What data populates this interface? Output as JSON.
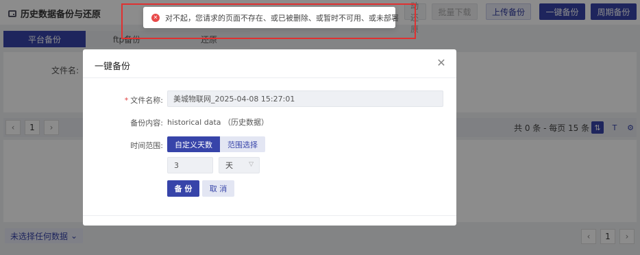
{
  "header": {
    "title": "历史数据备份与还原",
    "btn_auto": "自动还原",
    "btn_batch_download": "批量下载",
    "btn_upload": "上传备份",
    "btn_onekey": "一键备份",
    "btn_cycle": "周期备份"
  },
  "tabs": [
    {
      "label": "平台备份",
      "active": true
    },
    {
      "label": "ftp备份",
      "active": false
    },
    {
      "label": "还原",
      "active": false
    }
  ],
  "form": {
    "filename_label": "文件名:"
  },
  "pager": {
    "page": "1",
    "count": "共 0 条 - 每页 15 条"
  },
  "bottom": {
    "select_label": "未选择任何数据",
    "page": "1"
  },
  "modal": {
    "title": "一键备份",
    "filename_label": "文件名称:",
    "filename_value": "美城物联网_2025-04-08 15:27:01",
    "content_label": "备份内容:",
    "content_value": "historical data （历史数据）",
    "range_label": "时间范围:",
    "seg_custom": "自定义天数",
    "seg_range": "范围选择",
    "days_value": "3",
    "unit_value": "天",
    "btn_ok": "备 份",
    "btn_cancel": "取 消"
  },
  "toast": {
    "message": "对不起，您请求的页面不存在、或已被删除、或暂时不可用、或未部署"
  },
  "colors": {
    "primary": "#3744a9",
    "error": "#e84a4a"
  }
}
